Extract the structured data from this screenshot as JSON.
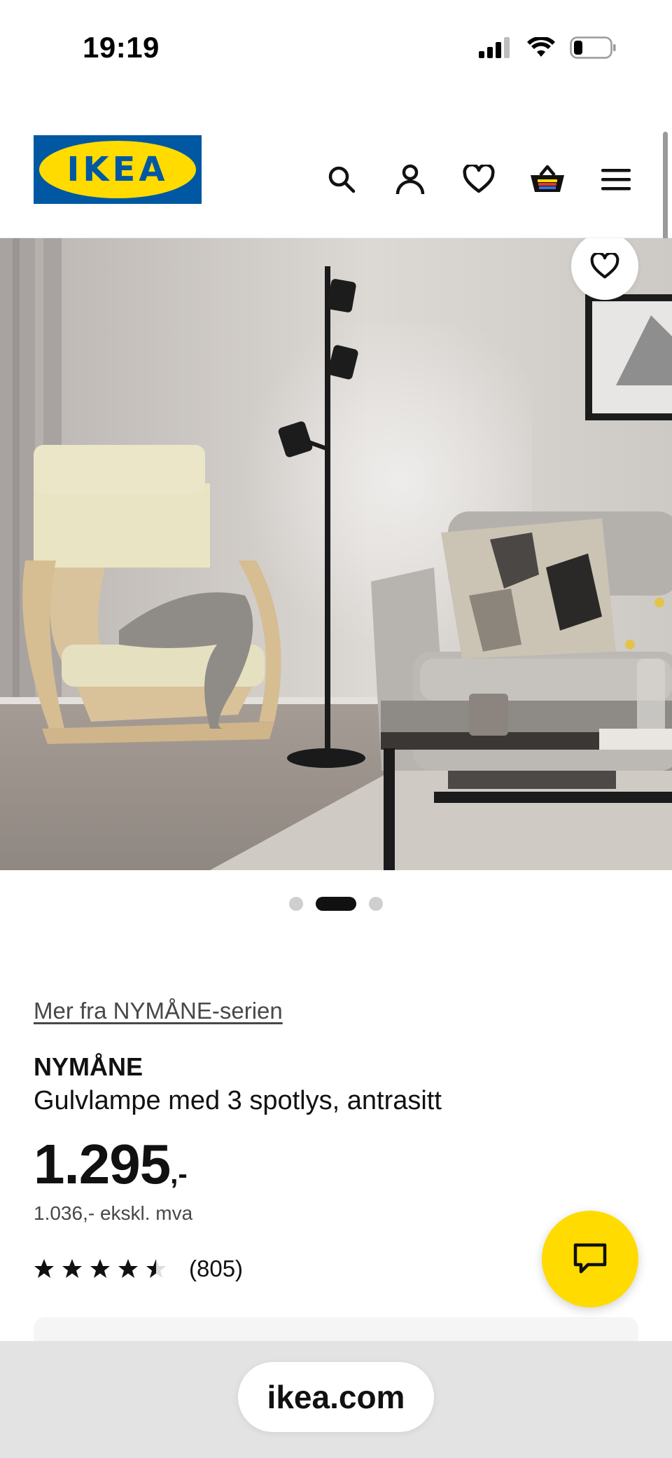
{
  "status_bar": {
    "time": "19:19",
    "icons": [
      "cellular-signal-icon",
      "wifi-icon",
      "battery-icon"
    ]
  },
  "header": {
    "logo_text": "IKEA",
    "nav_icons": [
      "search-icon",
      "account-icon",
      "heart-icon",
      "basket-icon",
      "menu-icon"
    ]
  },
  "hero": {
    "favorite_icon": "heart-icon",
    "carousel": {
      "count": 3,
      "active_index": 1
    }
  },
  "product": {
    "series_link": "Mer fra NYMÅNE-serien",
    "name": "NYMÅNE",
    "description": "Gulvlampe med 3 spotlys, antrasitt",
    "price_main": "1.295",
    "price_suffix": ",-",
    "price_ex_vat": "1.036,- ekskl. mva",
    "rating_value": 4.5,
    "rating_max": 5,
    "rating_count": "(805)"
  },
  "chat": {
    "icon": "chat-icon"
  },
  "browser": {
    "url": "ikea.com"
  },
  "colors": {
    "ikea_blue": "#0058a3",
    "ikea_yellow": "#ffdb00",
    "text": "#111111",
    "secondary_text": "#484848"
  }
}
